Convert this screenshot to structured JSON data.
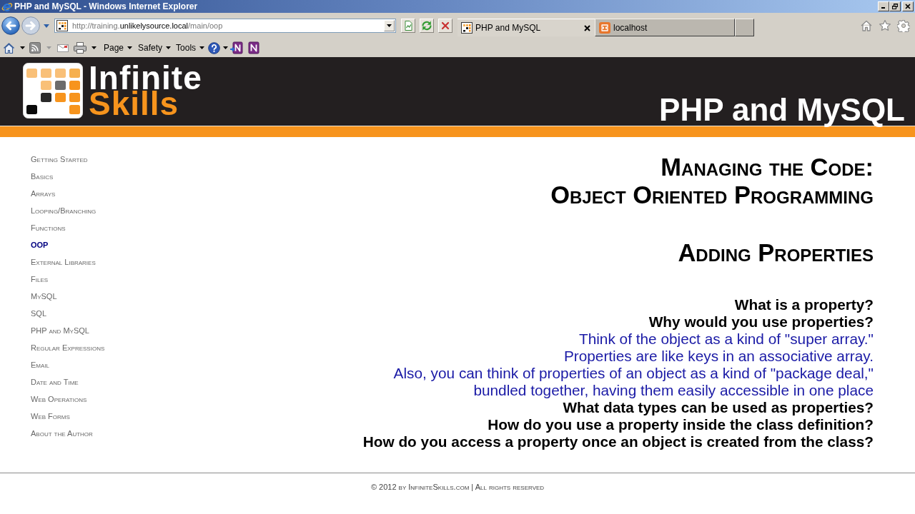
{
  "window": {
    "title": "PHP and MySQL - Windows Internet Explorer"
  },
  "address_bar": {
    "url": {
      "prefix": "http://training.",
      "domain": "unlikelysource.local",
      "path": "/main/oop"
    }
  },
  "tabs": [
    {
      "label": "PHP and MySQL",
      "selected": true
    },
    {
      "label": "localhost",
      "selected": false
    }
  ],
  "command_bar": {
    "menus": [
      "Page",
      "Safety",
      "Tools"
    ]
  },
  "site_header": {
    "logo": {
      "line_1": "Infinite",
      "line_2": "Skills"
    },
    "title": "PHP and MySQL"
  },
  "sidebar": {
    "items": [
      {
        "label": "Getting Started",
        "selected": false
      },
      {
        "label": "Basics",
        "selected": false
      },
      {
        "label": "Arrays",
        "selected": false
      },
      {
        "label": "Looping/Branching",
        "selected": false
      },
      {
        "label": "Functions",
        "selected": false
      },
      {
        "label": "OOP",
        "selected": true
      },
      {
        "label": "External Libraries",
        "selected": false
      },
      {
        "label": "Files",
        "selected": false
      },
      {
        "label": "MySQL",
        "selected": false
      },
      {
        "label": "SQL",
        "selected": false
      },
      {
        "label": "PHP and MySQL",
        "selected": false
      },
      {
        "label": "Regular Expressions",
        "selected": false
      },
      {
        "label": "Email",
        "selected": false
      },
      {
        "label": "Date and Time",
        "selected": false
      },
      {
        "label": "Web Operations",
        "selected": false
      },
      {
        "label": "Web Forms",
        "selected": false
      },
      {
        "label": "About the Author",
        "selected": false
      }
    ]
  },
  "content": {
    "heading_lines": [
      "Managing the Code:",
      "Object Oriented Programming"
    ],
    "subheading": "Adding Properties",
    "lines": [
      {
        "kind": "question",
        "text": "What is a property?"
      },
      {
        "kind": "question",
        "text": "Why would you use properties?"
      },
      {
        "kind": "note",
        "text": "Think of the object as a kind of \"super array.\""
      },
      {
        "kind": "note",
        "text": "Properties are like keys in an associative array."
      },
      {
        "kind": "note",
        "text": "Also, you can think of properties of an object as a kind of \"package deal,\""
      },
      {
        "kind": "note",
        "text": "bundled together, having them easily accessible in one place"
      },
      {
        "kind": "question",
        "text": "What data types can be used as properties?"
      },
      {
        "kind": "question",
        "text": "How do you use a property inside the class definition?"
      },
      {
        "kind": "question",
        "text": "How do you access a property once an object is created from the class?"
      }
    ]
  },
  "footer": {
    "text": "© 2012 by InfiniteSkills.com | All rights reserved"
  }
}
